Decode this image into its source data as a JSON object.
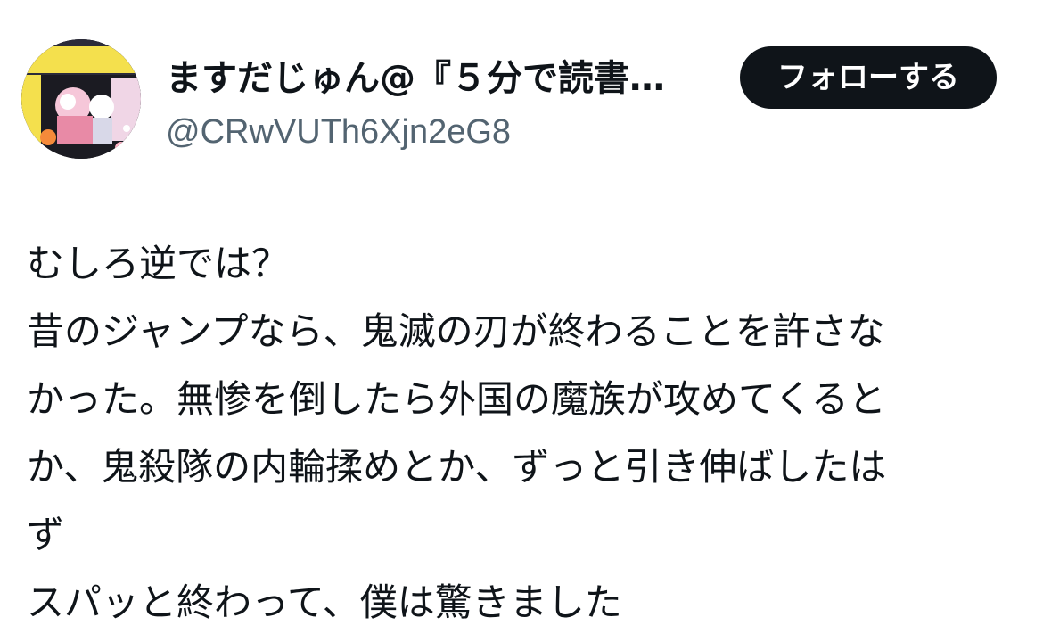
{
  "user": {
    "display_name": "ますだじゅん@『５分で読書…",
    "handle": "@CRwVUTh6Xjn2eG8",
    "avatar_icon": "book-cover-avatar"
  },
  "actions": {
    "follow_label": "フォローする"
  },
  "tweet": {
    "lines": [
      "むしろ逆では？",
      "昔のジャンプなら、鬼滅の刃が終わることを許さな",
      "かった。無惨を倒したら外国の魔族が攻めてくると",
      "か、鬼殺隊の内輪揉めとか、ずっと引き伸ばしたは",
      "ず",
      "スパッと終わって、僕は驚きました"
    ]
  },
  "colors": {
    "text": "#0f1419",
    "secondary": "#536471",
    "button_bg": "#0f1419",
    "button_text": "#ffffff"
  }
}
